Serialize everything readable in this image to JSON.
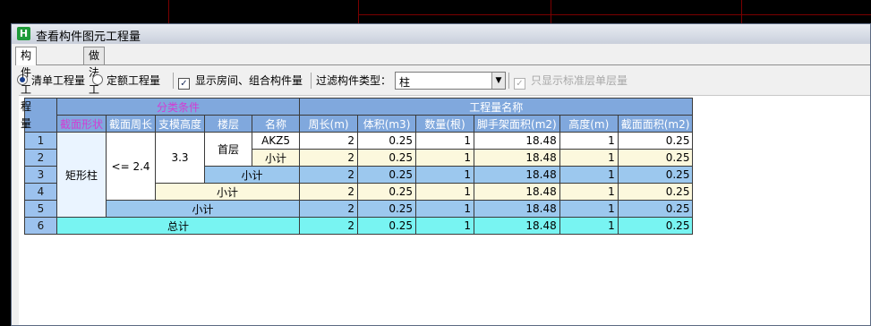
{
  "window": {
    "title": "查看构件图元工程量",
    "app_icon_glyph": "H"
  },
  "tabs": [
    {
      "label": "构件工程量"
    },
    {
      "label": "做法工程量"
    }
  ],
  "toolbar": {
    "radio_list_qty": "清单工程量",
    "radio_quota_qty": "定额工程量",
    "show_room_label": "显示房间、组合构件量",
    "filter_label": "过滤构件类型：",
    "filter_value": "柱",
    "standard_floor_label": "只显示标准层单层量"
  },
  "grid": {
    "group_headers": {
      "classify": "分类条件",
      "quantity_names": "工程量名称"
    },
    "columns": [
      "截面形状",
      "截面周长",
      "支模高度",
      "楼层",
      "名称",
      "周长(m)",
      "体积(m3)",
      "数量(根)",
      "脚手架面积(m2)",
      "高度(m)",
      "截面面积(m2)"
    ],
    "row_numbers": [
      "1",
      "2",
      "3",
      "4",
      "5",
      "6"
    ],
    "labels": {
      "shape": "矩形柱",
      "perimeter": "<= 2.4",
      "height": "3.3",
      "floor": "首层",
      "name": "AKZ5",
      "subtotal": "小计",
      "total": "总计"
    },
    "rows": [
      [
        "2",
        "0.25",
        "1",
        "18.48",
        "1",
        "0.25"
      ],
      [
        "2",
        "0.25",
        "1",
        "18.48",
        "1",
        "0.25"
      ],
      [
        "2",
        "0.25",
        "1",
        "18.48",
        "1",
        "0.25"
      ],
      [
        "2",
        "0.25",
        "1",
        "18.48",
        "1",
        "0.25"
      ],
      [
        "2",
        "0.25",
        "1",
        "18.48",
        "1",
        "0.25"
      ],
      [
        "2",
        "0.25",
        "1",
        "18.48",
        "1",
        "0.25"
      ]
    ]
  }
}
